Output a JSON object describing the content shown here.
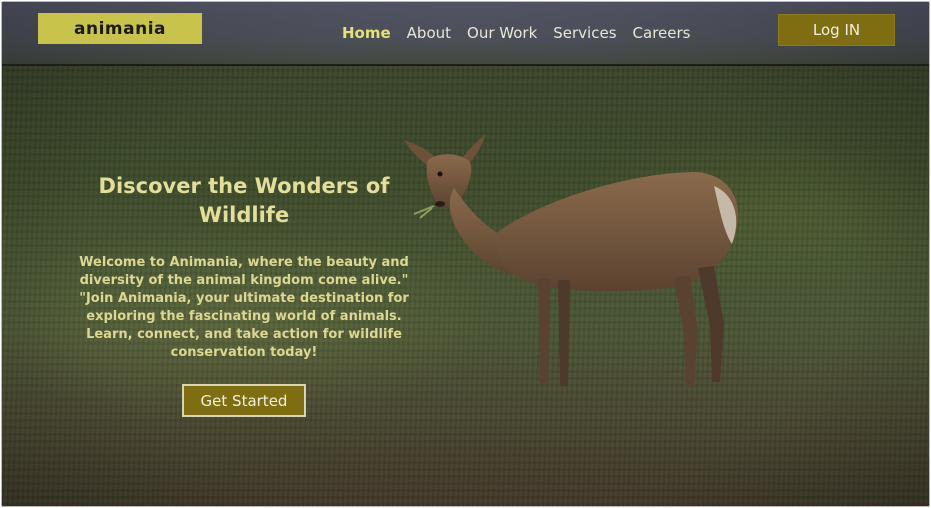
{
  "header": {
    "logo": "animania",
    "nav": [
      {
        "label": "Home",
        "active": true
      },
      {
        "label": "About",
        "active": false
      },
      {
        "label": "Our Work",
        "active": false
      },
      {
        "label": "Services",
        "active": false
      },
      {
        "label": "Careers",
        "active": false
      }
    ],
    "login_label": "Log IN"
  },
  "hero": {
    "title": "Discover the Wonders of Wildlife",
    "description": "Welcome to Animania, where the beauty and diversity of the animal kingdom come alive.\" \"Join Animania, your ultimate destination for exploring the fascinating world of animals. Learn, connect, and take action for wildlife conservation today!",
    "cta_label": "Get Started"
  },
  "colors": {
    "accent": "#c7c34b",
    "button": "#7e6e11",
    "heading": "#e3df9b",
    "active_nav": "#e7e07a"
  }
}
